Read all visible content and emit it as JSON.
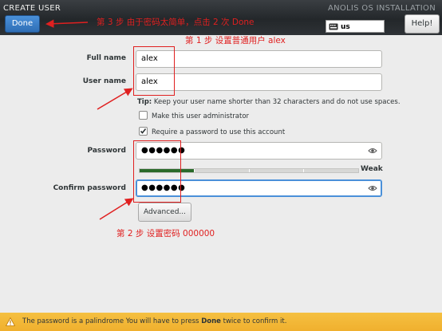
{
  "header": {
    "title": "CREATE USER",
    "installer_title": "ANOLIS OS INSTALLATION",
    "done_label": "Done",
    "help_label": "Help!",
    "keyboard_layout": "us"
  },
  "annotations": {
    "step3": "第 3 步 由于密码太简单，点击 2 次 Done",
    "step1": "第 1 步 设置普通用户 alex",
    "step2": "第 2 步 设置密码 000000"
  },
  "form": {
    "full_name_label": "Full name",
    "full_name_value": "alex",
    "user_name_label": "User name",
    "user_name_value": "alex",
    "tip_label": "Tip:",
    "tip_text": " Keep your user name shorter than 32 characters and do not use spaces.",
    "admin_label": "Make this user administrator",
    "admin_checked": false,
    "require_pw_label": "Require a password to use this account",
    "require_pw_checked": true,
    "password_label": "Password",
    "password_value": "●●●●●●",
    "strength_label": "Weak",
    "strength_fraction": 0.25,
    "confirm_label": "Confirm password",
    "confirm_value": "●●●●●●",
    "advanced_label": "Advanced..."
  },
  "warning": {
    "text_before": "The password is a palindrome You will have to press ",
    "text_bold": "Done",
    "text_after": " twice to confirm it."
  },
  "colors": {
    "annotation": "#e02020",
    "done_button": "#3d80c8",
    "warning_bar": "#f2b535",
    "strength_fill": "#2a6a2a"
  }
}
